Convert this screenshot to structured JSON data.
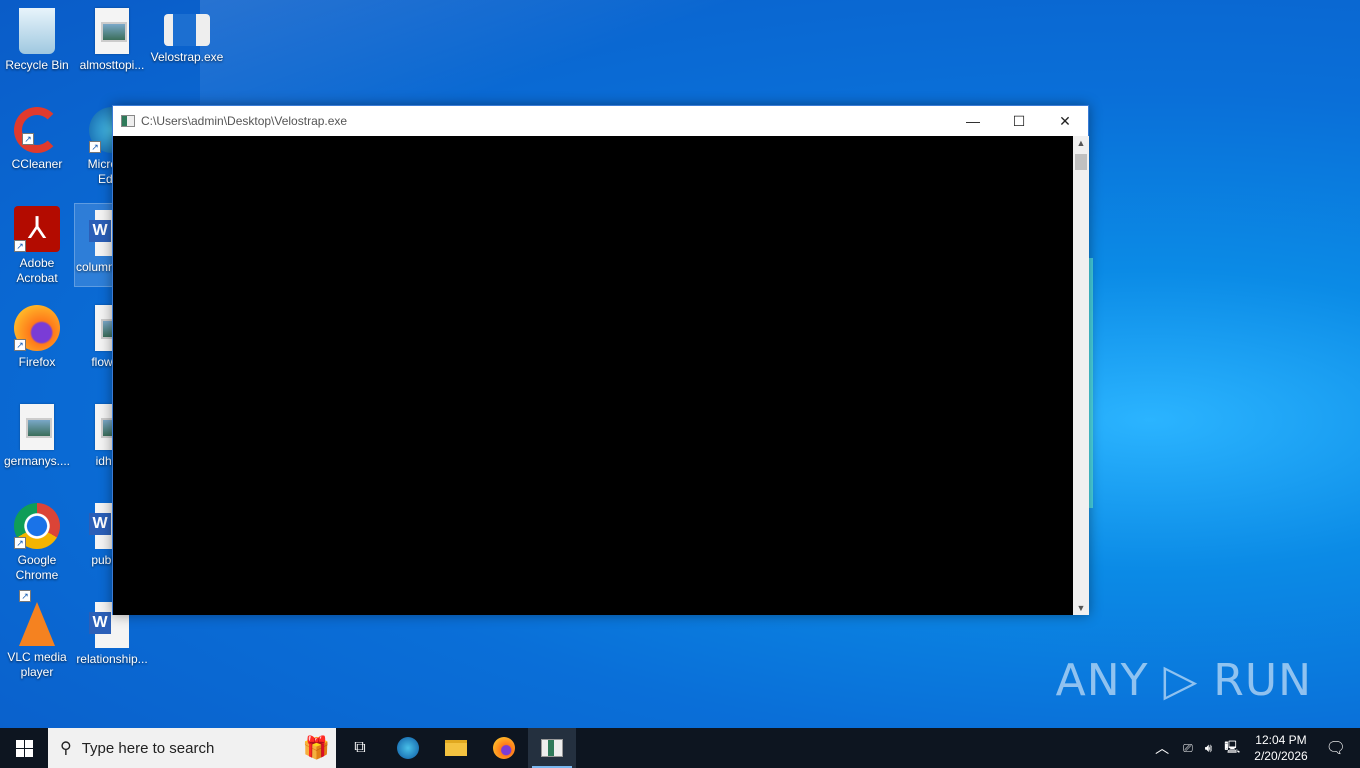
{
  "desktop": {
    "icons": [
      {
        "label": "Recycle Bin",
        "type": "recycle-bin"
      },
      {
        "label": "almosttopi...",
        "type": "image-file"
      },
      {
        "label": "Velostrap.exe",
        "type": "exe"
      },
      {
        "label": "CCleaner",
        "type": "ccleaner"
      },
      {
        "label": "Microsoft Edge",
        "type": "edge"
      },
      {
        "label": "Adobe Acrobat",
        "type": "acrobat"
      },
      {
        "label": "columnmbe...",
        "type": "word"
      },
      {
        "label": "Firefox",
        "type": "firefox"
      },
      {
        "label": "flowm...",
        "type": "image-file"
      },
      {
        "label": "germanys....",
        "type": "image-file"
      },
      {
        "label": "idhe...",
        "type": "image-file"
      },
      {
        "label": "Google Chrome",
        "type": "chrome"
      },
      {
        "label": "public...",
        "type": "word"
      },
      {
        "label": "VLC media player",
        "type": "vlc"
      },
      {
        "label": "relationship...",
        "type": "word"
      }
    ]
  },
  "window": {
    "title": "C:\\Users\\admin\\Desktop\\Velostrap.exe",
    "minimize": "—",
    "maximize": "☐",
    "close": "✕"
  },
  "taskbar": {
    "search_placeholder": "Type here to search",
    "time": "12:04 PM",
    "date": "2/20/2026"
  },
  "watermark": "ANY ▷ RUN"
}
